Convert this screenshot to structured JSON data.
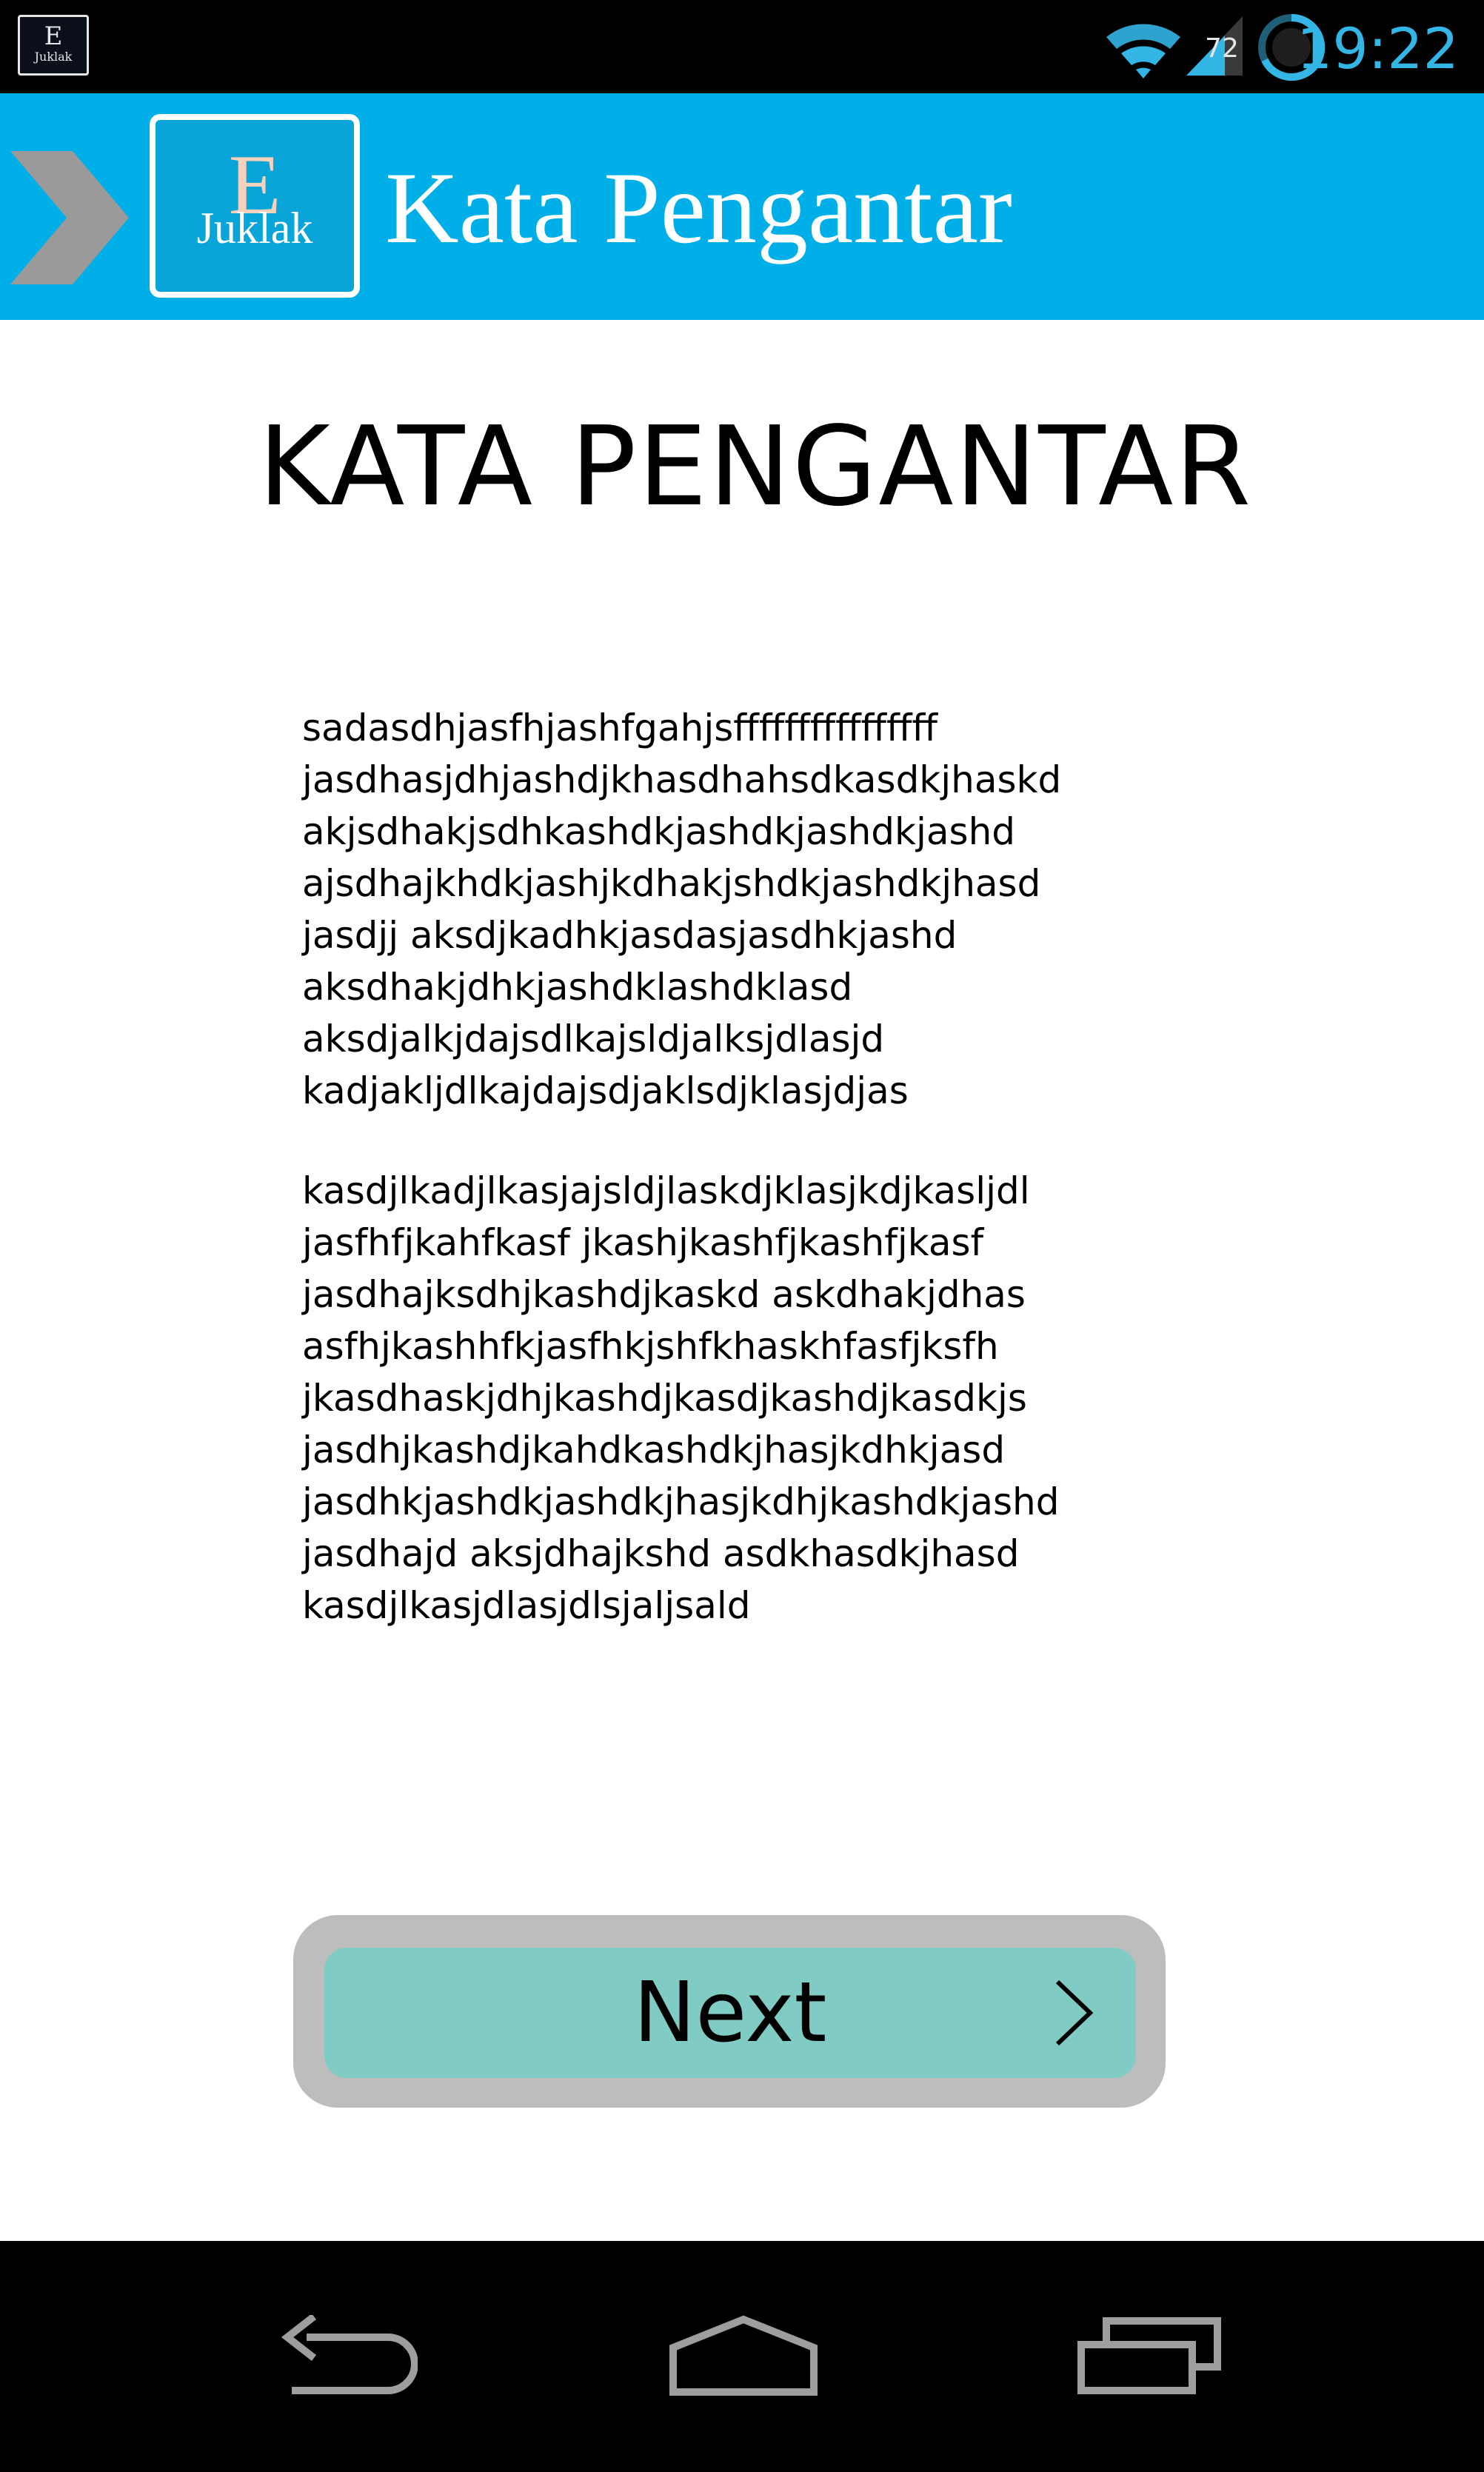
{
  "status_bar": {
    "app_icon": {
      "letter": "E",
      "caption": "Juklak"
    },
    "battery_level": "72",
    "time": "19:22",
    "icons": [
      "wifi-icon",
      "signal-icon",
      "battery-icon"
    ]
  },
  "action_bar": {
    "logo": {
      "letter": "E",
      "caption": "Juklak"
    },
    "title": "Kata Pengantar",
    "colors": {
      "background": "#00aee8",
      "title": "#ffffff"
    },
    "icons": [
      "chevron-right-icon"
    ]
  },
  "content": {
    "heading": "KATA PENGANTAR",
    "paragraph1": [
      "sadasdhjasfhjashfgahjsffffffffffffffff",
      "jasdhasjdhjashdjkhasdhahsdkasdkjhaskd",
      "akjsdhakjsdhkashdkjashdkjashdkjashd",
      "ajsdhajkhdkjashjkdhakjshdkjashdkjhasd",
      "jasdjj aksdjkadhkjasdasjasdhkjashd",
      "aksdhakjdhkjashdklashdklasd",
      "aksdjalkjdajsdlkajsldjalksjdlasjd",
      "kadjakljdlkajdajsdjaklsdjklasjdjas"
    ],
    "paragraph2": [
      "kasdjlkadjlkasjajsldjlaskdjklasjkdjkasljdl",
      "jasfhfjkahfkasf jkashjkashfjkashfjkasf",
      "jasdhajksdhjkashdjkaskd askdhakjdhas",
      "asfhjkashhfkjasfhkjshfkhaskhfasfjksfh",
      "jkasdhaskjdhjkashdjkasdjkashdjkasdkjs",
      "jasdhjkashdjkahdkashdkjhasjkdhkjasd",
      "jasdhkjashdkjashdkjhasjkdhjkashdkjashd",
      "jasdhajd aksjdhajkshd asdkhasdkjhasd",
      "kasdjlkasjdlasjdlsjaljsald"
    ]
  },
  "next_button": {
    "label": "Next",
    "icon": "chevron-right-icon",
    "colors": {
      "outer": "#bdbdbd",
      "inner": "#80cbc4"
    }
  },
  "nav_bar": {
    "icons": [
      "back-icon",
      "home-icon",
      "recent-apps-icon"
    ]
  }
}
